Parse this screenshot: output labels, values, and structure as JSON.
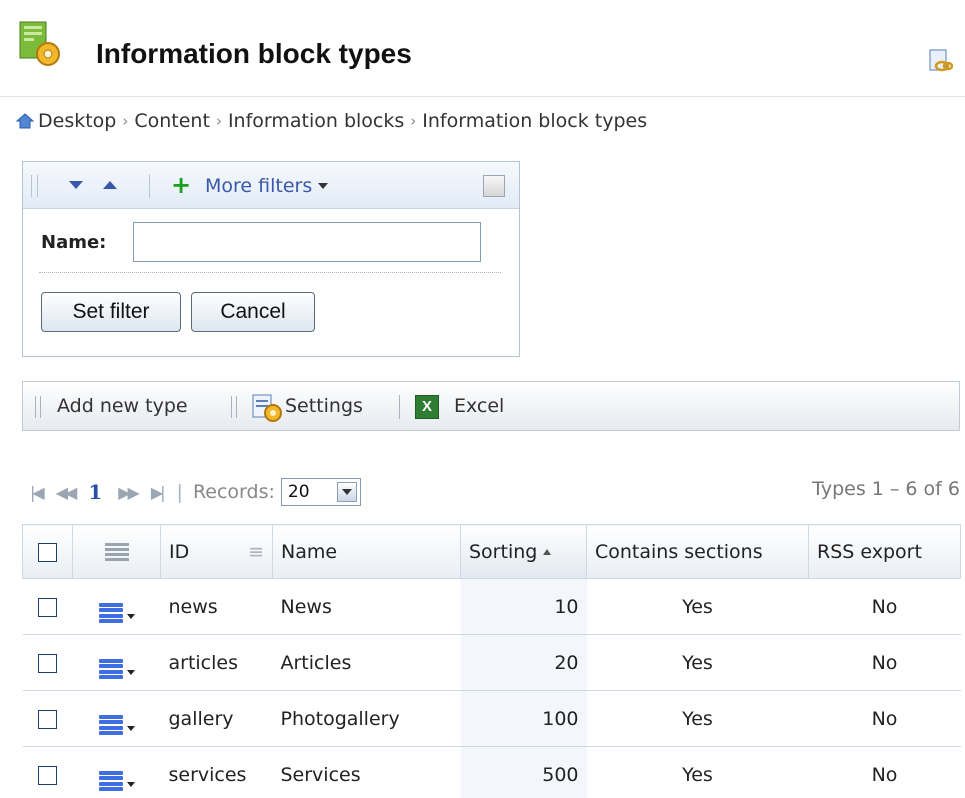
{
  "header": {
    "title": "Information block types"
  },
  "breadcrumb": [
    "Desktop",
    "Content",
    "Information blocks",
    "Information block types"
  ],
  "filter": {
    "more_filters_label": "More filters",
    "name_label": "Name:",
    "name_value": "",
    "set_filter_label": "Set filter",
    "cancel_label": "Cancel"
  },
  "toolbar": {
    "add_new_label": "Add new type",
    "settings_label": "Settings",
    "excel_label": "Excel"
  },
  "pager": {
    "current_page": "1",
    "records_label": "Records:",
    "records_value": "20",
    "summary": "Types 1 – 6 of 6"
  },
  "grid": {
    "columns": [
      "ID",
      "Name",
      "Sorting",
      "Contains sections",
      "RSS export"
    ],
    "rows": [
      {
        "id": "news",
        "name": "News",
        "sorting": "10",
        "sections": "Yes",
        "rss": "No"
      },
      {
        "id": "articles",
        "name": "Articles",
        "sorting": "20",
        "sections": "Yes",
        "rss": "No"
      },
      {
        "id": "gallery",
        "name": "Photogallery",
        "sorting": "100",
        "sections": "Yes",
        "rss": "No"
      },
      {
        "id": "services",
        "name": "Services",
        "sorting": "500",
        "sections": "Yes",
        "rss": "No"
      }
    ]
  },
  "colors": {
    "accent": "#3a58a8",
    "link": "#2650a8",
    "border": "#b5c4d5"
  },
  "icons": [
    "iblock-types-icon",
    "link-icon",
    "home-icon",
    "arrow-down-icon",
    "arrow-up-icon",
    "plus-icon",
    "settings-icon",
    "excel-icon",
    "row-menu-icon"
  ]
}
